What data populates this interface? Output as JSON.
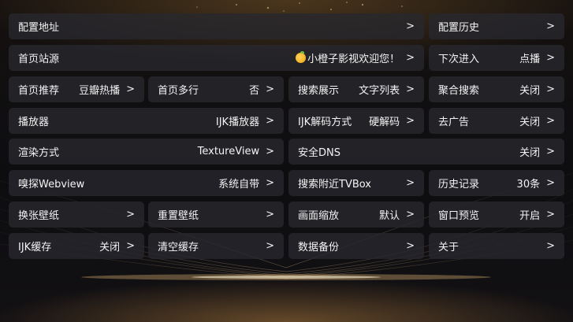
{
  "rows": [
    {
      "items": [
        {
          "label": "配置地址",
          "value": "",
          "chevron": ">"
        },
        {
          "label": "配置历史",
          "value": "",
          "chevron": ">"
        }
      ]
    },
    {
      "items": [
        {
          "label": "首页站源",
          "value": "小橙子影视欢迎您！",
          "chevron": ">",
          "icon": "orange-icon"
        },
        {
          "label": "下次进入",
          "value": "点播",
          "chevron": ">"
        }
      ]
    },
    {
      "items": [
        {
          "label": "首页推荐",
          "value": "豆瓣热播",
          "chevron": ">"
        },
        {
          "label": "首页多行",
          "value": "否",
          "chevron": ">"
        },
        {
          "label": "搜索展示",
          "value": "文字列表",
          "chevron": ">"
        },
        {
          "label": "聚合搜索",
          "value": "关闭",
          "chevron": ">"
        }
      ]
    },
    {
      "items": [
        {
          "label": "播放器",
          "value": "IJK播放器",
          "chevron": ">"
        },
        {
          "label": "IJK解码方式",
          "value": "硬解码",
          "chevron": ">"
        },
        {
          "label": "去广告",
          "value": "关闭",
          "chevron": ">"
        }
      ]
    },
    {
      "items": [
        {
          "label": "渲染方式",
          "value": "TextureView",
          "chevron": ">"
        },
        {
          "label": "安全DNS",
          "value": "关闭",
          "chevron": ">"
        }
      ]
    },
    {
      "items": [
        {
          "label": "嗅探Webview",
          "value": "系统自带",
          "chevron": ">"
        },
        {
          "label": "搜索附近TVBox",
          "value": "",
          "chevron": ">"
        },
        {
          "label": "历史记录",
          "value": "30条",
          "chevron": ">"
        }
      ]
    },
    {
      "items": [
        {
          "label": "换张壁纸",
          "value": "",
          "chevron": ">"
        },
        {
          "label": "重置壁纸",
          "value": "",
          "chevron": ">"
        },
        {
          "label": "画面缩放",
          "value": "默认",
          "chevron": ">"
        },
        {
          "label": "窗口预览",
          "value": "开启",
          "chevron": ">"
        }
      ]
    },
    {
      "items": [
        {
          "label": "IJK缓存",
          "value": "关闭",
          "chevron": ">"
        },
        {
          "label": "清空缓存",
          "value": "",
          "chevron": ">"
        },
        {
          "label": "数据备份",
          "value": "",
          "chevron": ">"
        },
        {
          "label": "关于",
          "value": "",
          "chevron": ">"
        }
      ]
    }
  ]
}
